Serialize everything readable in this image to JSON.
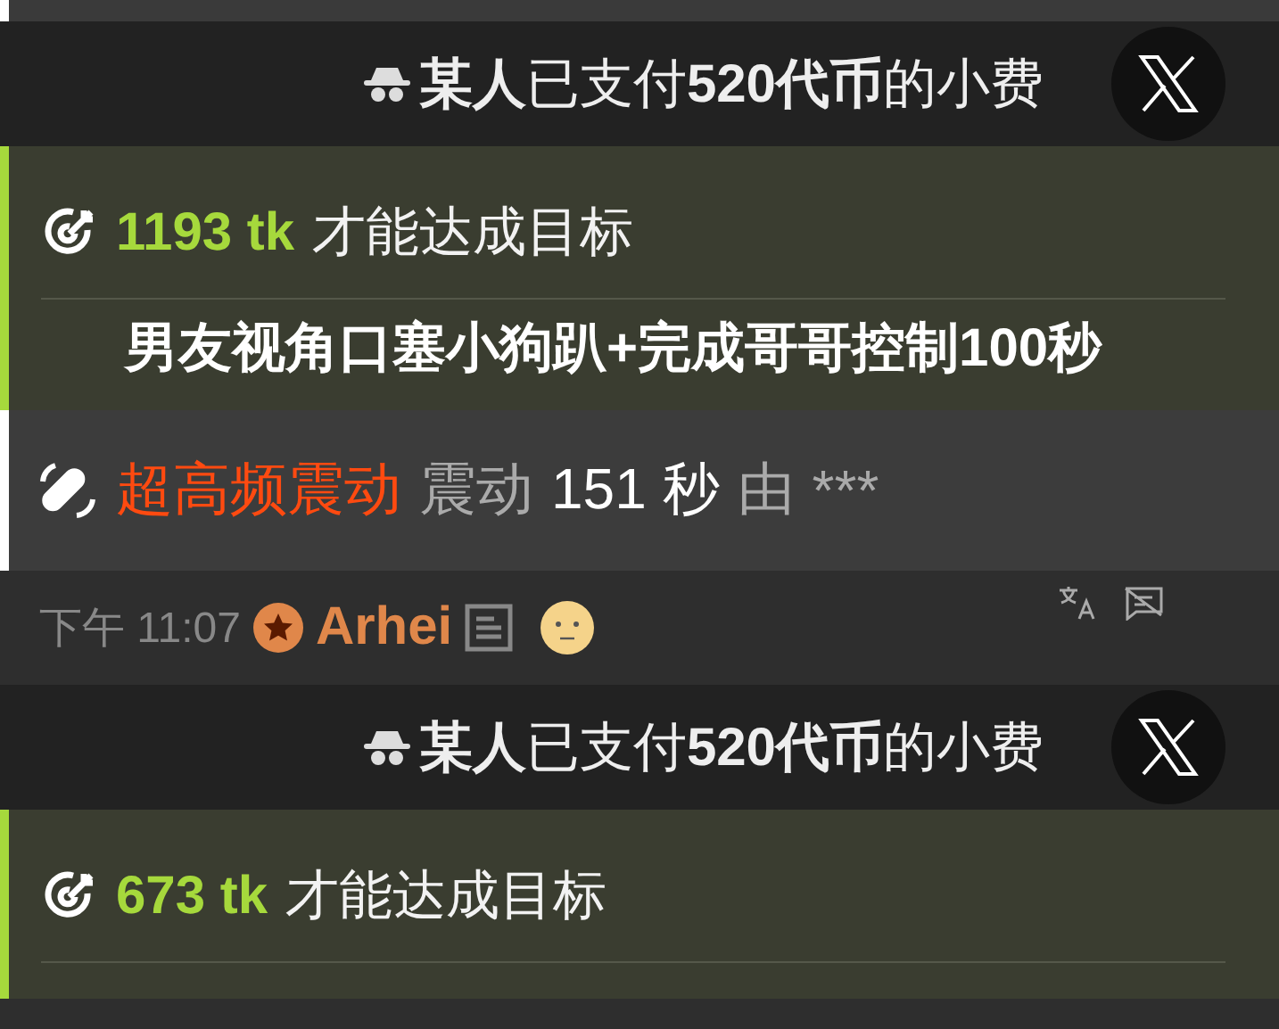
{
  "messages": [
    {
      "kind": "tip",
      "text": "**某人**已支付**520代币**的小费"
    },
    {
      "kind": "goal",
      "amount": "1193 tk",
      "text": "才能达成目标",
      "description": "男友视角口塞小狗趴+完成哥哥控制100秒"
    },
    {
      "kind": "action",
      "name": "超高频震动",
      "verb": "震动",
      "duration": "151 秒",
      "by": "由",
      "user": "***"
    },
    {
      "kind": "meta",
      "time": "下午 11:07",
      "username": "Arhei"
    },
    {
      "kind": "tip",
      "text": "**某人**已支付**520代币**的小费"
    },
    {
      "kind": "goal",
      "amount": "673 tk",
      "text": "才能达成目标"
    }
  ]
}
